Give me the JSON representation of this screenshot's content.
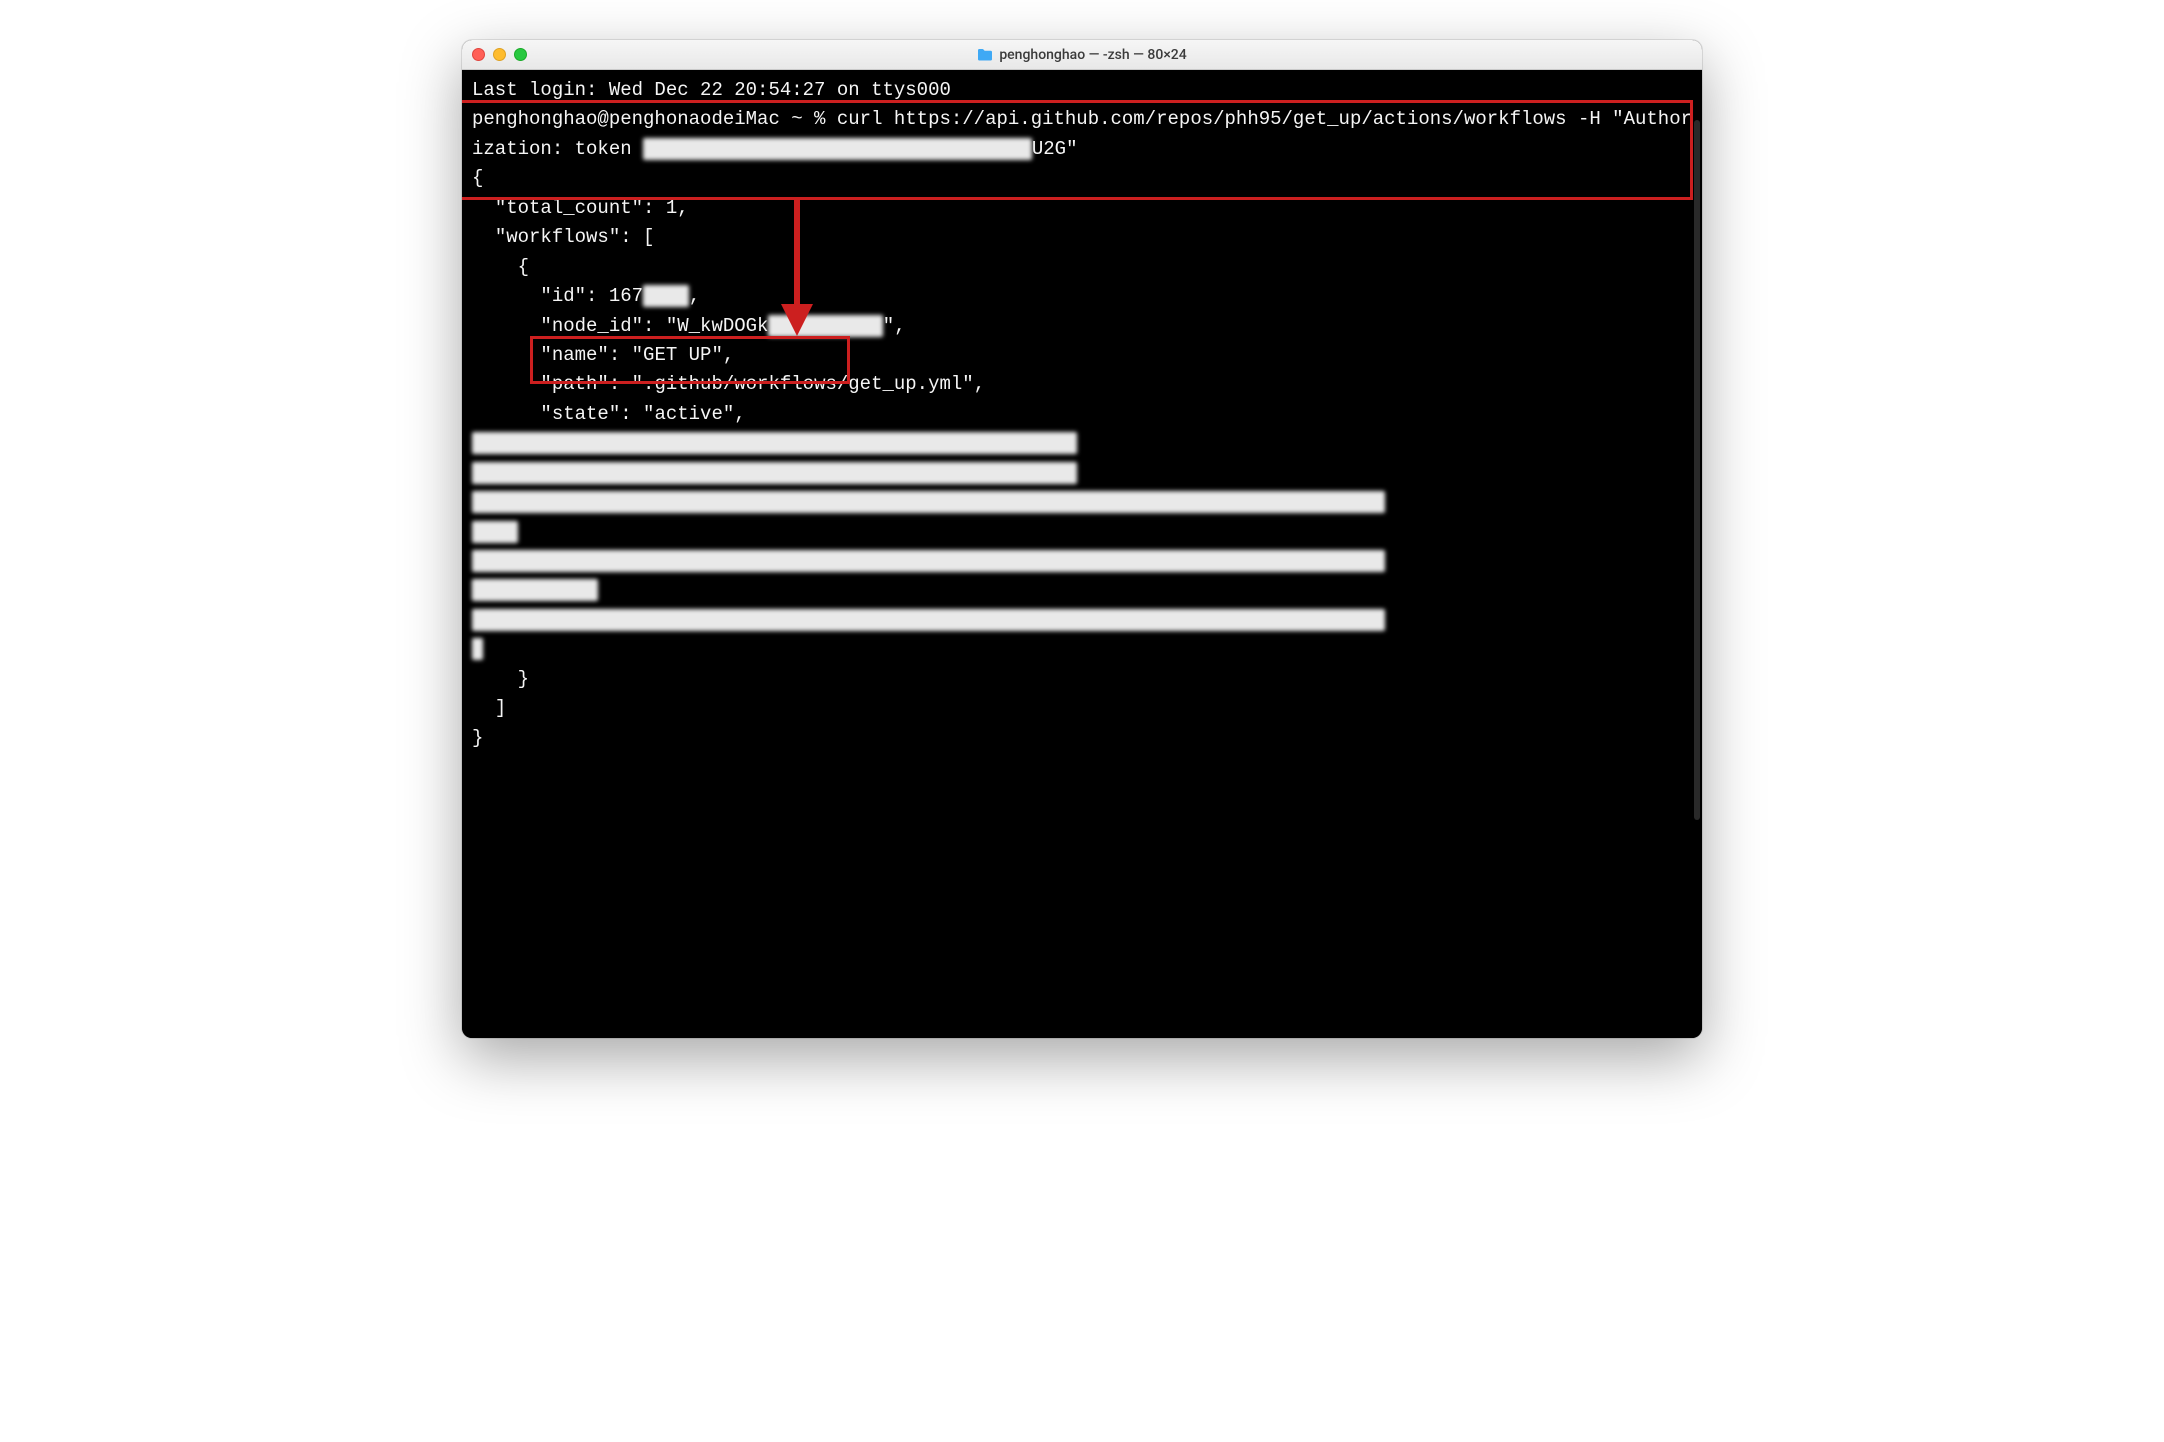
{
  "window": {
    "title": "penghonghao — -zsh — 80×24"
  },
  "terminal": {
    "last_login": "Last login: Wed Dec 22 20:54:27 on ttys000",
    "prompt": "penghonghao@penghonaodeiMac ~ % ",
    "command_pre_token": "curl https://api.github.com/repos/phh95/get_up/actions/workflows -H \"Authorization: token ",
    "token_obscured": "g▇p_▇▇▇▇▇▇▇▇▇▇▇▇▇▇▇▇▇▇▇▇▇▇▇▇▇▇▇▇▇▇",
    "command_post_token": "U2G\"",
    "response": {
      "open": "{",
      "total_count_key": "  \"total_count\": ",
      "total_count_val": "1",
      "total_count_tail": ",",
      "workflows_open": "  \"workflows\": [",
      "item_open": "    {",
      "id_pre": "      \"id\": ",
      "id_val_visible": "167",
      "id_val_obscured": "▇▇▇▇",
      "id_tail": ",",
      "node_id_pre": "      \"node_id\": \"W_kwDOGk",
      "node_id_obscured": "▇▇▇ ▇▇ ▇▇▇",
      "node_id_tail": "\",",
      "name_line": "      \"name\": \"GET UP\",",
      "path_line": "      \"path\": \".github/workflows/get_up.yml\",",
      "state_line": "      \"state\": \"active\",",
      "obsc_line1": "      \"▇▇▇▇▇▇▇▇_▇▇\": \"▇▇▇▇-▇▇-▇▇T12:3▇:▇1.▇▇▇▇d▇:▇▇\",",
      "obsc_line2": "      \"▇▇▇▇▇▇▇▇_▇▇\": \"▇▇▇▇-▇▇-▇▇T12:▇▇:▇1.▇▇▇▇d▇:▇▇\",",
      "obsc_url_1": "      \"u▇l\": \"ht▇▇▇://▇pi.git▇u▇.o▇m/r▇po▇/▇h▇9▇/g▇▇ up/a▇▇ion▇/wo▇kflow▇/1▇▇1▇0",
      "obsc_url_1_cont": "A▇\",",
      "obsc_html_url": "      \"ht▇_url\": \"h▇t▇▇://▇ith▇b.▇o▇/▇hh9▇/g▇▇_▇p/b▇▇▇h/m▇i▇/.▇ith▇b/wo▇kflow▇/g",
      "obsc_html_url_cont": "▇t_▇p.▇m▇\",",
      "obsc_badge": "      \"badg▇_▇▇▇\": \"▇ttp▇://g▇▇▇ub.c▇m/ph▇9▇/g▇t_u▇/wo▇kf▇▇w▇/▇E▇%▇8U▇/▇▇dg▇.s▇g",
      "obsc_badge_cont": "\"",
      "item_close": "    }",
      "array_close": "  ]",
      "close": "}"
    }
  },
  "colors": {
    "annotation": "#cc1f1f"
  }
}
